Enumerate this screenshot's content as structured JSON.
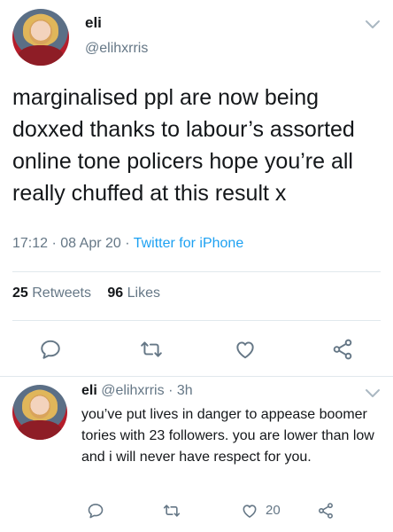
{
  "main": {
    "name": "eli",
    "handle": "@elihxrris",
    "text": "marginalised ppl are now being doxxed thanks to labour’s assorted online tone policers hope you’re all really chuffed at this result x",
    "time": "17:12",
    "date": "08 Apr 20",
    "source": "Twitter for iPhone",
    "retweet_count": "25",
    "retweet_label": "Retweets",
    "like_count": "96",
    "like_label": "Likes"
  },
  "reply": {
    "name": "eli",
    "handle": "@elihxrris",
    "age": "3h",
    "text": "you’ve put lives in danger to appease boomer tories with 23 followers. you are lower than low and i will never have respect for you.",
    "like_count": "20"
  },
  "icons": {
    "reply": "reply-bubble-icon",
    "retweet": "retweet-icon",
    "like": "heart-icon",
    "share": "share-icon",
    "menu": "chevron-down-icon"
  },
  "colors": {
    "text": "#14171a",
    "muted": "#657786",
    "link": "#1da1f2",
    "divider": "#e1e8ed"
  }
}
